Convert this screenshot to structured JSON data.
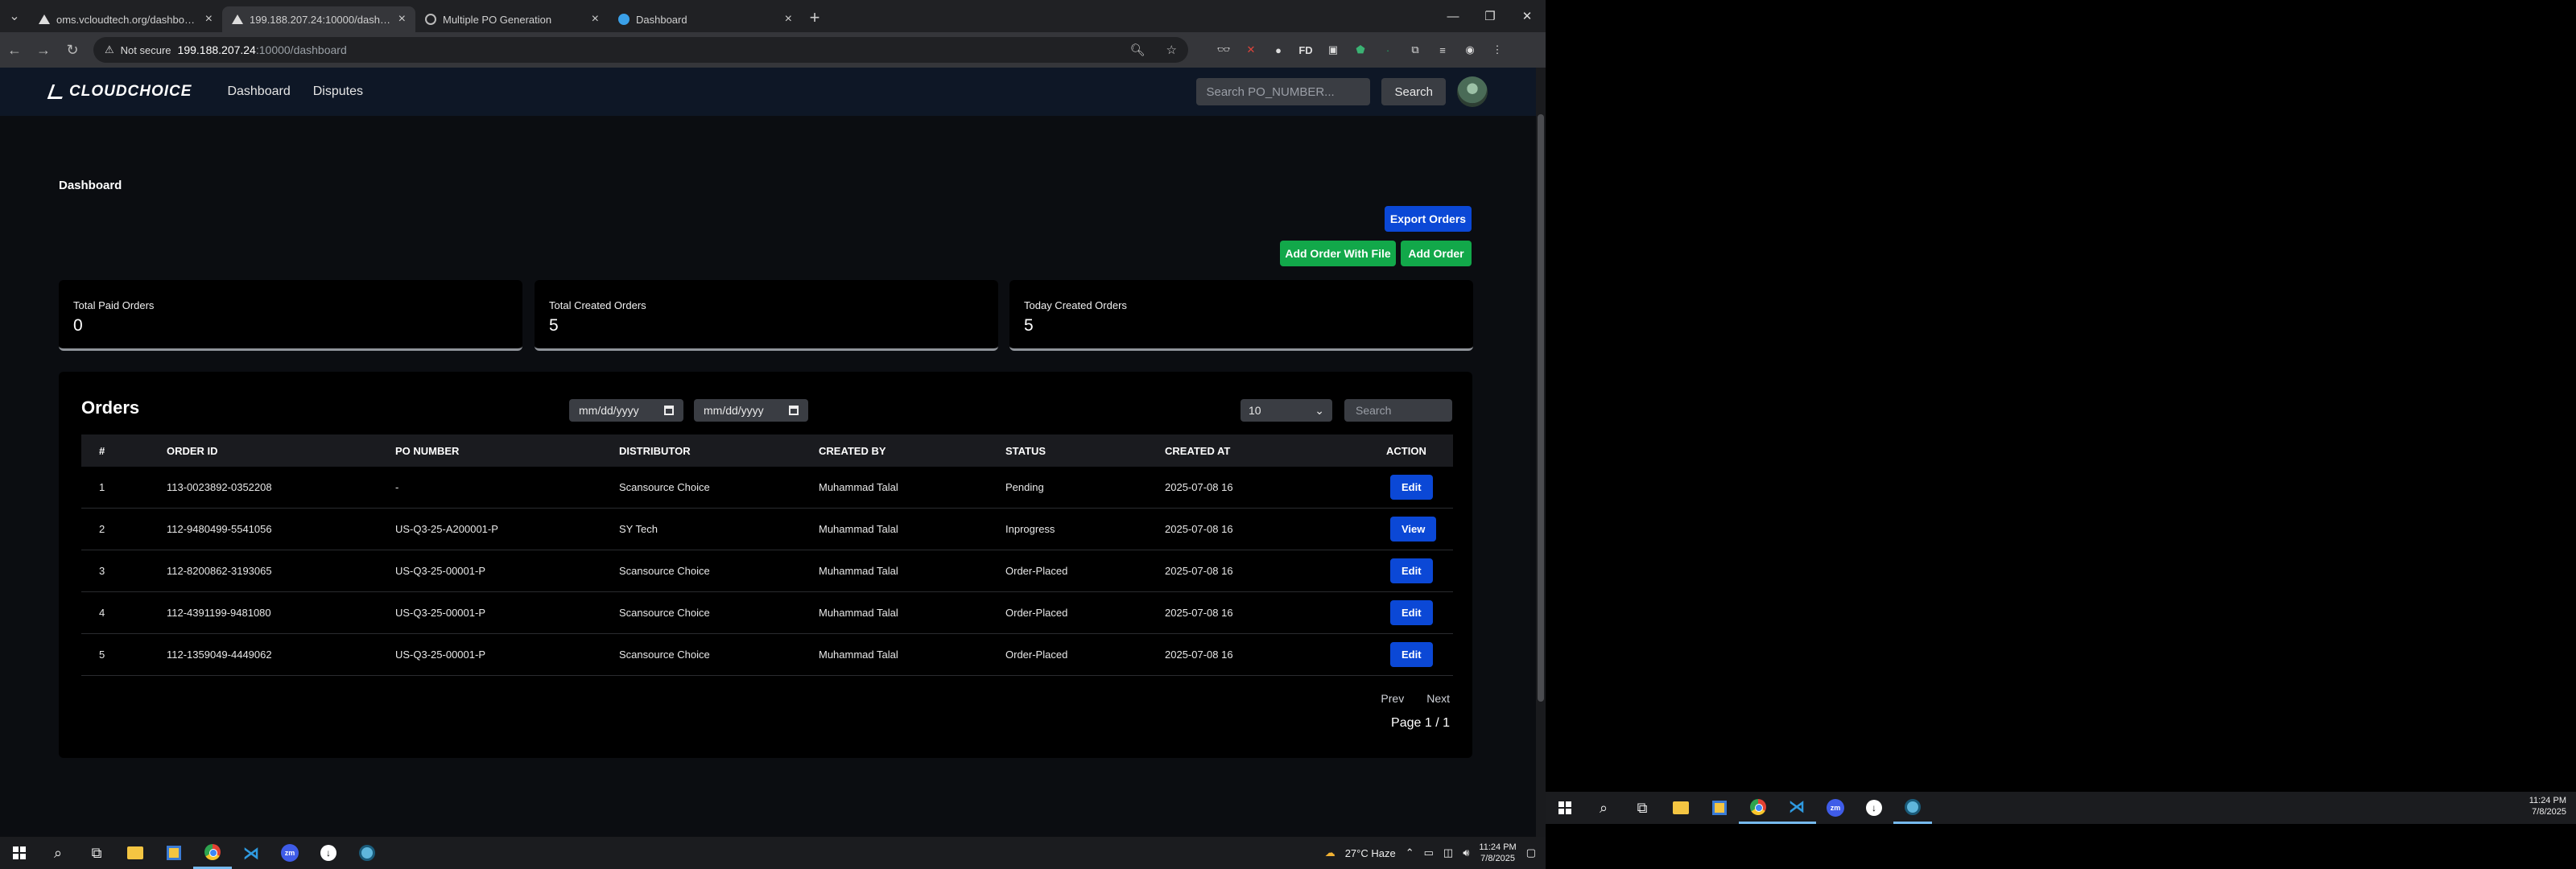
{
  "browser": {
    "tabs": [
      {
        "title": "oms.vcloudtech.org/dashboard",
        "active": false
      },
      {
        "title": "199.188.207.24:10000/dashboard",
        "active": true
      },
      {
        "title": "Multiple PO Generation",
        "active": false
      },
      {
        "title": "Dashboard",
        "active": false
      }
    ],
    "security_label": "Not secure",
    "url_host": "199.188.207.24",
    "url_path": ":10000/dashboard"
  },
  "app": {
    "brand": "CLOUDCHOICE",
    "nav": [
      "Dashboard",
      "Disputes"
    ],
    "search_placeholder": "Search PO_NUMBER...",
    "search_button": "Search"
  },
  "dashboard": {
    "title": "Dashboard",
    "export_button": "Export Orders",
    "add_with_file_button": "Add Order With File",
    "add_button": "Add Order",
    "stats": [
      {
        "label": "Total Paid Orders",
        "value": "0"
      },
      {
        "label": "Total Created Orders",
        "value": "5"
      },
      {
        "label": "Today Created Orders",
        "value": "5"
      }
    ]
  },
  "orders": {
    "title": "Orders",
    "date_from_placeholder": "mm/dd/yyyy",
    "date_to_placeholder": "mm/dd/yyyy",
    "page_size": "10",
    "search_placeholder": "Search",
    "columns": [
      "#",
      "ORDER ID",
      "PO NUMBER",
      "DISTRIBUTOR",
      "CREATED BY",
      "STATUS",
      "CREATED AT",
      "ACTION"
    ],
    "rows": [
      {
        "n": "1",
        "order_id": "113-0023892-0352208",
        "po": "-",
        "distributor": "Scansource Choice",
        "created_by": "Muhammad Talal",
        "status": "Pending",
        "created_at": "2025-07-08 16",
        "action": "Edit"
      },
      {
        "n": "2",
        "order_id": "112-9480499-5541056",
        "po": "US-Q3-25-A200001-P",
        "distributor": "SY Tech",
        "created_by": "Muhammad Talal",
        "status": "Inprogress",
        "created_at": "2025-07-08 16",
        "action": "View"
      },
      {
        "n": "3",
        "order_id": "112-8200862-3193065",
        "po": "US-Q3-25-00001-P",
        "distributor": "Scansource Choice",
        "created_by": "Muhammad Talal",
        "status": "Order-Placed",
        "created_at": "2025-07-08 16",
        "action": "Edit"
      },
      {
        "n": "4",
        "order_id": "112-4391199-9481080",
        "po": "US-Q3-25-00001-P",
        "distributor": "Scansource Choice",
        "created_by": "Muhammad Talal",
        "status": "Order-Placed",
        "created_at": "2025-07-08 16",
        "action": "Edit"
      },
      {
        "n": "5",
        "order_id": "112-1359049-4449062",
        "po": "US-Q3-25-00001-P",
        "distributor": "Scansource Choice",
        "created_by": "Muhammad Talal",
        "status": "Order-Placed",
        "created_at": "2025-07-08 16",
        "action": "Edit"
      }
    ],
    "prev_label": "Prev",
    "next_label": "Next",
    "page_info": "Page 1 / 1"
  },
  "taskbar": {
    "weather": "27°C  Haze",
    "time": "11:24 PM",
    "date": "7/8/2025"
  },
  "taskbar_right": {
    "time": "11:24 PM",
    "date": "7/8/2025"
  }
}
